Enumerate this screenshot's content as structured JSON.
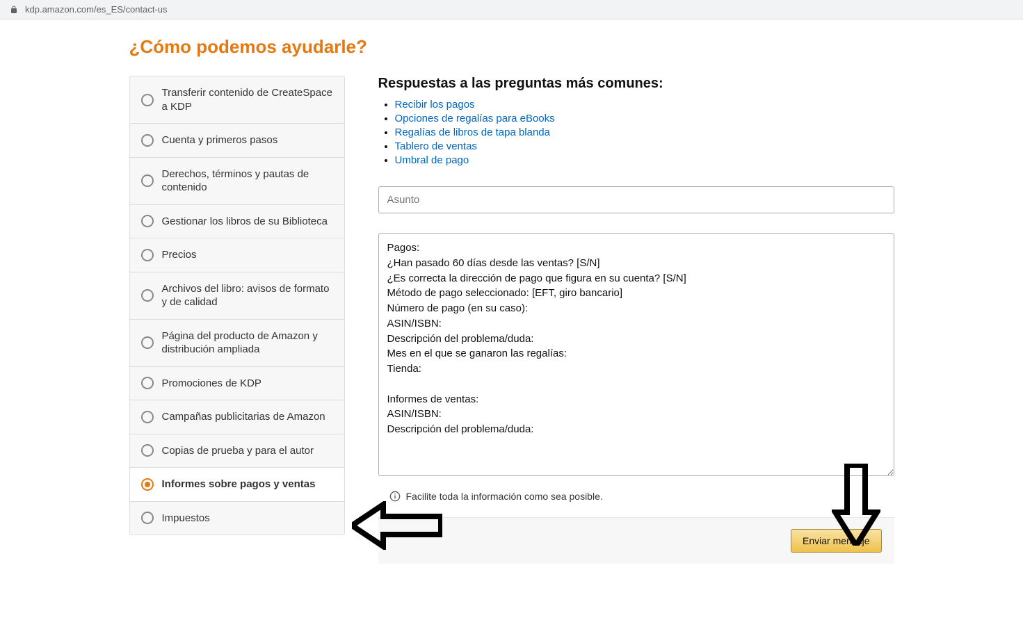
{
  "url": "kdp.amazon.com/es_ES/contact-us",
  "page_title": "¿Cómo podemos ayudarle?",
  "sidebar": {
    "items": [
      {
        "label": "Transferir contenido de CreateSpace a KDP",
        "selected": false
      },
      {
        "label": "Cuenta y primeros pasos",
        "selected": false
      },
      {
        "label": "Derechos, términos y pautas de contenido",
        "selected": false
      },
      {
        "label": "Gestionar los libros de su Biblioteca",
        "selected": false
      },
      {
        "label": "Precios",
        "selected": false
      },
      {
        "label": "Archivos del libro: avisos de formato y de calidad",
        "selected": false
      },
      {
        "label": "Página del producto de Amazon y distribución ampliada",
        "selected": false
      },
      {
        "label": "Promociones de KDP",
        "selected": false
      },
      {
        "label": "Campañas publicitarias de Amazon",
        "selected": false
      },
      {
        "label": "Copias de prueba y para el autor",
        "selected": false
      },
      {
        "label": "Informes sobre pagos y ventas",
        "selected": true
      },
      {
        "label": "Impuestos",
        "selected": false
      }
    ]
  },
  "faq": {
    "heading": "Respuestas a las preguntas más comunes:",
    "links": [
      "Recibir los pagos",
      "Opciones de regalías para eBooks",
      "Regalías de libros de tapa blanda",
      "Tablero de ventas",
      "Umbral de pago"
    ]
  },
  "form": {
    "subject_placeholder": "Asunto",
    "message_value": "Pagos:\n¿Han pasado 60 días desde las ventas? [S/N]\n¿Es correcta la dirección de pago que figura en su cuenta? [S/N]\nMétodo de pago seleccionado: [EFT, giro bancario]\nNúmero de pago (en su caso):\nASIN/ISBN:\nDescripción del problema/duda:\nMes en el que se ganaron las regalías:\nTienda:\n\nInformes de ventas:\nASIN/ISBN:\nDescripción del problema/duda:",
    "hint": "Facilite toda la información como sea posible.",
    "submit_label": "Enviar mensaje"
  }
}
